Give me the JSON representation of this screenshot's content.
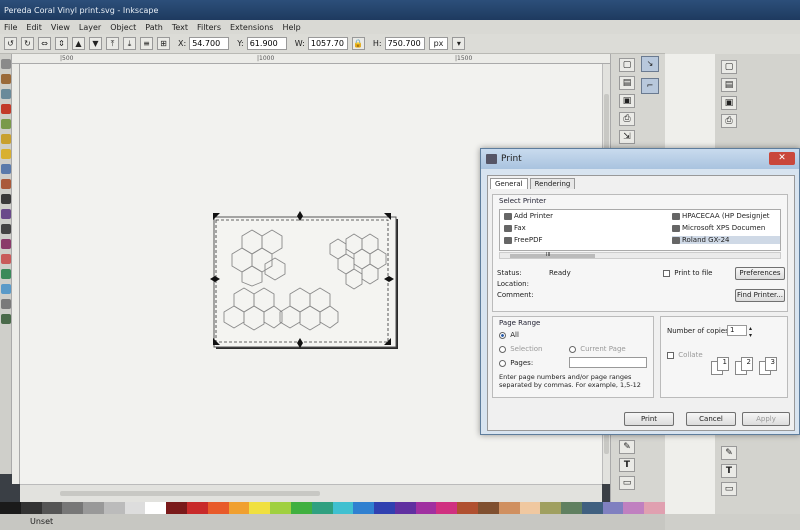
{
  "app": {
    "window_title": "Pereda Coral Vinyl print.svg - Inkscape",
    "menu": [
      "File",
      "Edit",
      "View",
      "Layer",
      "Object",
      "Path",
      "Text",
      "Filters",
      "Extensions",
      "Help"
    ]
  },
  "toolbar": {
    "x_label": "X:",
    "x_value": "54.700",
    "y_label": "Y:",
    "y_value": "61.900",
    "w_label": "W:",
    "w_value": "1057.70",
    "h_label": "H:",
    "h_value": "750.700",
    "unit": "px"
  },
  "ruler": {
    "mark_1": "|500",
    "mark_2": "|1000",
    "mark_3": "|1500"
  },
  "statusbar": {
    "text": "Unset"
  },
  "print_dialog": {
    "title": "Print",
    "tabs": [
      "General",
      "Rendering"
    ],
    "select_printer_label": "Select Printer",
    "printers": [
      "Add Printer",
      "Fax",
      "FreePDF",
      "HPACECAA (HP Designjet",
      "Microsoft XPS Documen",
      "Roland GX-24"
    ],
    "selected_printer": "Roland GX-24",
    "scroll_glyph": "III",
    "status_label": "Status:",
    "status_value": "Ready",
    "location_label": "Location:",
    "comment_label": "Comment:",
    "print_to_file_label": "Print to file",
    "preferences_label": "Preferences",
    "find_printer_label": "Find Printer...",
    "page_range_label": "Page Range",
    "range_all": "All",
    "range_selection": "Selection",
    "range_current": "Current Page",
    "range_pages": "Pages:",
    "pages_hint": "Enter page numbers and/or page ranges separated by commas. For example, 1,5-12",
    "copies_label": "Number of copies:",
    "copies_value": "1",
    "collate_label": "Collate",
    "print_button": "Print",
    "cancel_button": "Cancel",
    "apply_button": "Apply",
    "close_glyph": "✕"
  },
  "icons": [
    "inkscape-icon",
    "printer-icon",
    "close-icon",
    "pointer-icon",
    "text-icon",
    "zoom-icon"
  ],
  "colors": {
    "titlebar": "#1e3a5f",
    "dialog_bg": "#d8e4f0",
    "close_red": "#c9473b",
    "selection_handle": "#111111"
  }
}
